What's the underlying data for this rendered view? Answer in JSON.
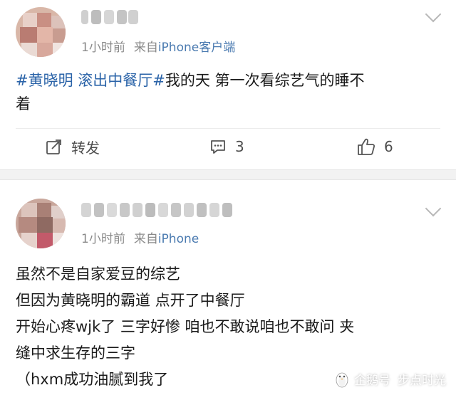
{
  "post1": {
    "time": "1小时前",
    "source_prefix": "来自",
    "source_app": "iPhone客户端",
    "hashtag": "#黄晓明 滚出中餐厅#",
    "text_line1_rest": "我的天 第一次看综艺气的睡不",
    "text_line2": "着",
    "actions": {
      "repost_label": "转发",
      "comment_count": "3",
      "like_count": "6"
    }
  },
  "post2": {
    "time": "1小时前",
    "source_prefix": "来自",
    "source_app": "iPhone",
    "lines": [
      "虽然不是自家爱豆的综艺",
      "但因为黄晓明的霸道 点开了中餐厅",
      "开始心疼wjk了 三字好惨 咱也不敢说咱也不敢问 夹",
      "缝中求生存的三字",
      "（hxm成功油腻到我了"
    ]
  },
  "watermark": {
    "brand": "企鹅号",
    "author": "步点时光"
  },
  "colors": {
    "link": "#2a63a8",
    "source": "#4a7ab0",
    "meta": "#8a8a8a",
    "separator": "#f2f2f2"
  },
  "icons": [
    "repost-icon",
    "comment-icon",
    "like-icon",
    "chevron-down-icon",
    "penguin-icon"
  ]
}
